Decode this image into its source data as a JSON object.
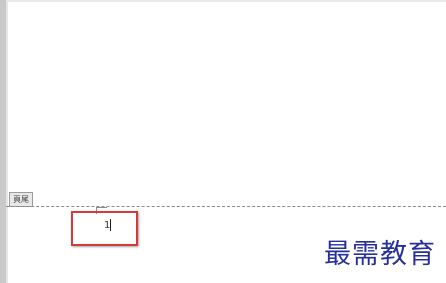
{
  "document": {
    "footer_label": "頁尾",
    "page_number": "1"
  },
  "watermark": {
    "text": "最需教育"
  },
  "colors": {
    "highlight": "#d43a3a",
    "watermark": "#27309a",
    "footer_tab_bg": "#e8e8e8"
  }
}
